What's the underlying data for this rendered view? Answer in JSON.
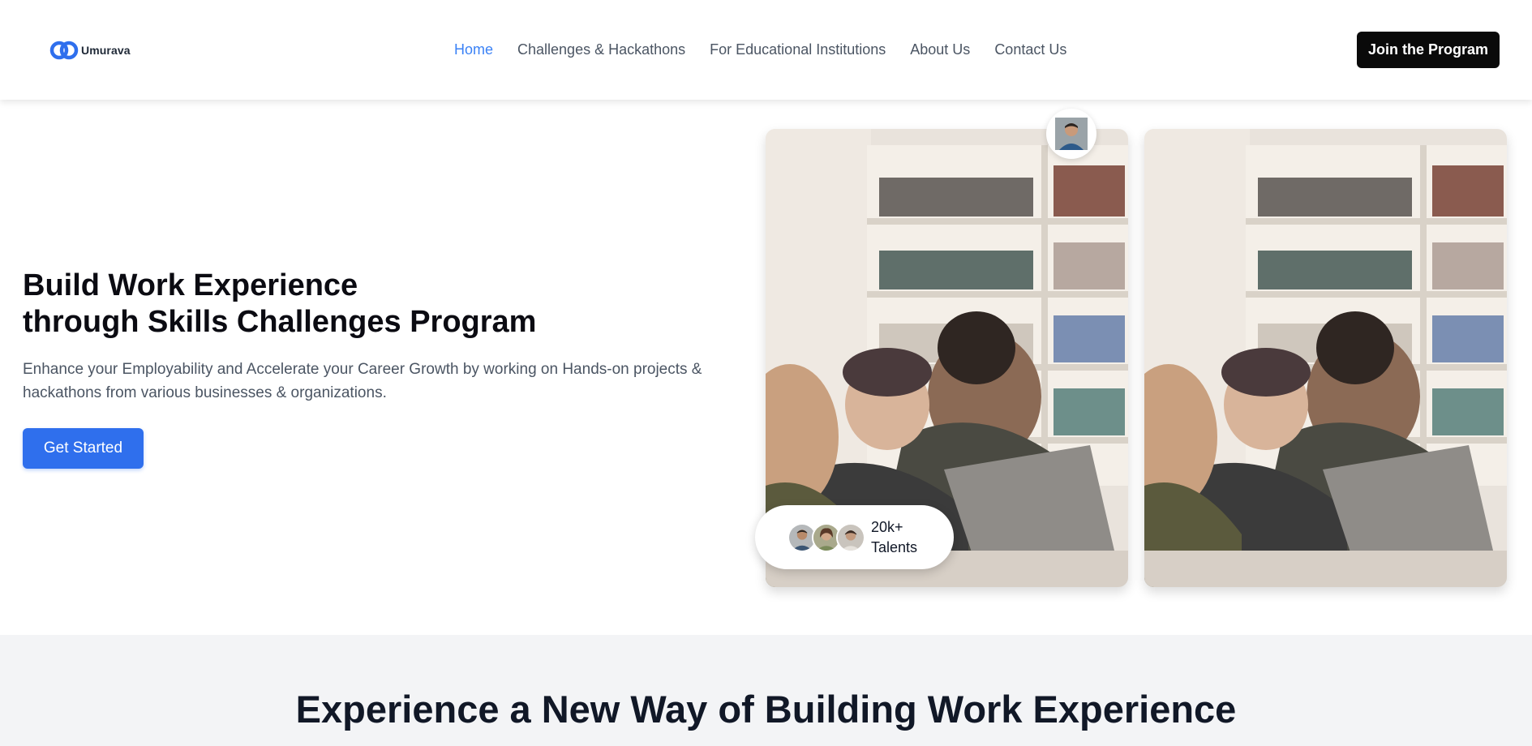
{
  "brand": {
    "name": "Umurava",
    "color": "#2f6fed"
  },
  "nav": {
    "items": [
      {
        "label": "Home",
        "active": true
      },
      {
        "label": "Challenges & Hackathons",
        "active": false
      },
      {
        "label": "For Educational Institutions",
        "active": false
      },
      {
        "label": "About Us",
        "active": false
      },
      {
        "label": "Contact Us",
        "active": false
      }
    ],
    "cta_label": "Join the Program"
  },
  "hero": {
    "title_line1": "Build Work Experience",
    "title_line2": "through Skills Challenges Program",
    "subtitle": "Enhance your Employability and Accelerate your Career Growth by working on Hands-on projects & hackathons from various businesses & organizations.",
    "cta_label": "Get Started",
    "images": [
      {
        "icon": "students-laptop-photo"
      },
      {
        "icon": "students-laptop-photo"
      }
    ],
    "avatar_icon": "user-avatar",
    "talents": {
      "count": "20k+",
      "label": "Talents"
    }
  },
  "section": {
    "title": "Experience a New Way of Building Work Experience"
  },
  "colors": {
    "accent": "#2f6fed",
    "link_active": "#3b82f6",
    "dark": "#0a0a0a",
    "section_bg": "#f3f4f6"
  }
}
